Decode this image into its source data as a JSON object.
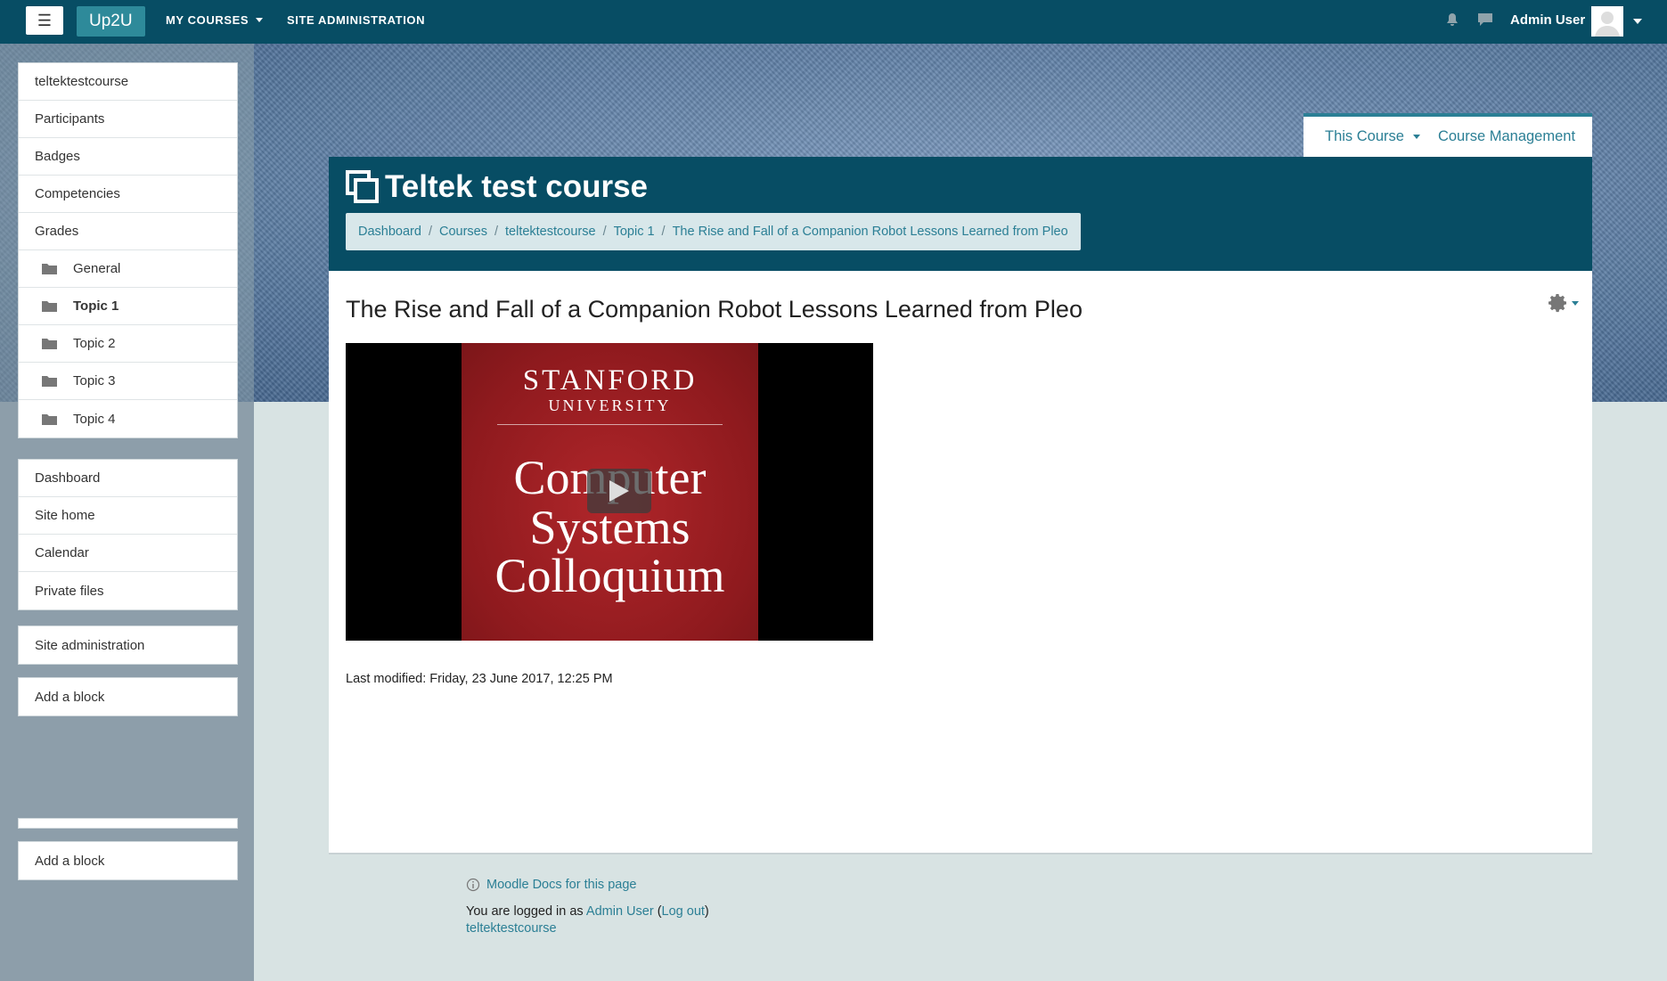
{
  "navbar": {
    "toggle_icon": "☰",
    "brand": "Up2U",
    "my_courses": "MY COURSES",
    "site_administration": "SITE ADMINISTRATION",
    "user_name": "Admin User"
  },
  "sidebar": {
    "course_nav": [
      {
        "label": "teltektestcourse"
      },
      {
        "label": "Participants"
      },
      {
        "label": "Badges"
      },
      {
        "label": "Competencies"
      },
      {
        "label": "Grades"
      }
    ],
    "sections": [
      {
        "label": "General"
      },
      {
        "label": "Topic 1"
      },
      {
        "label": "Topic 2"
      },
      {
        "label": "Topic 3"
      },
      {
        "label": "Topic 4"
      }
    ],
    "site_nav": [
      {
        "label": "Dashboard"
      },
      {
        "label": "Site home"
      },
      {
        "label": "Calendar"
      },
      {
        "label": "Private files"
      }
    ],
    "site_admin": "Site administration",
    "add_block_1": "Add a block",
    "add_block_2": "Add a block"
  },
  "tabs": {
    "this_course": "This Course",
    "course_management": "Course Management"
  },
  "header": {
    "course_title": "Teltek test course",
    "breadcrumb": [
      "Dashboard",
      "Courses",
      "teltektestcourse",
      "Topic 1",
      "The Rise and Fall of a Companion Robot Lessons Learned from Pleo"
    ],
    "breadcrumb_sep": "/"
  },
  "main": {
    "heading": "The Rise and Fall of a Companion Robot Lessons Learned from Pleo",
    "video": {
      "line1": "STANFORD",
      "line2": "UNIVERSITY",
      "line3": "Computer",
      "line4": "Systems",
      "line5": "Colloquium"
    },
    "last_modified": "Last modified: Friday, 23 June 2017, 12:25 PM"
  },
  "footer": {
    "docs_link": "Moodle Docs for this page",
    "logged_in_prefix": "You are logged in as",
    "user_link": "Admin User",
    "logout_link": "Log out",
    "course_link": "teltektestcourse"
  },
  "colors": {
    "navbar": "#074d64",
    "brand": "#2e8a9a",
    "link": "#2b7f95",
    "page_bg": "#d8e3e3"
  }
}
